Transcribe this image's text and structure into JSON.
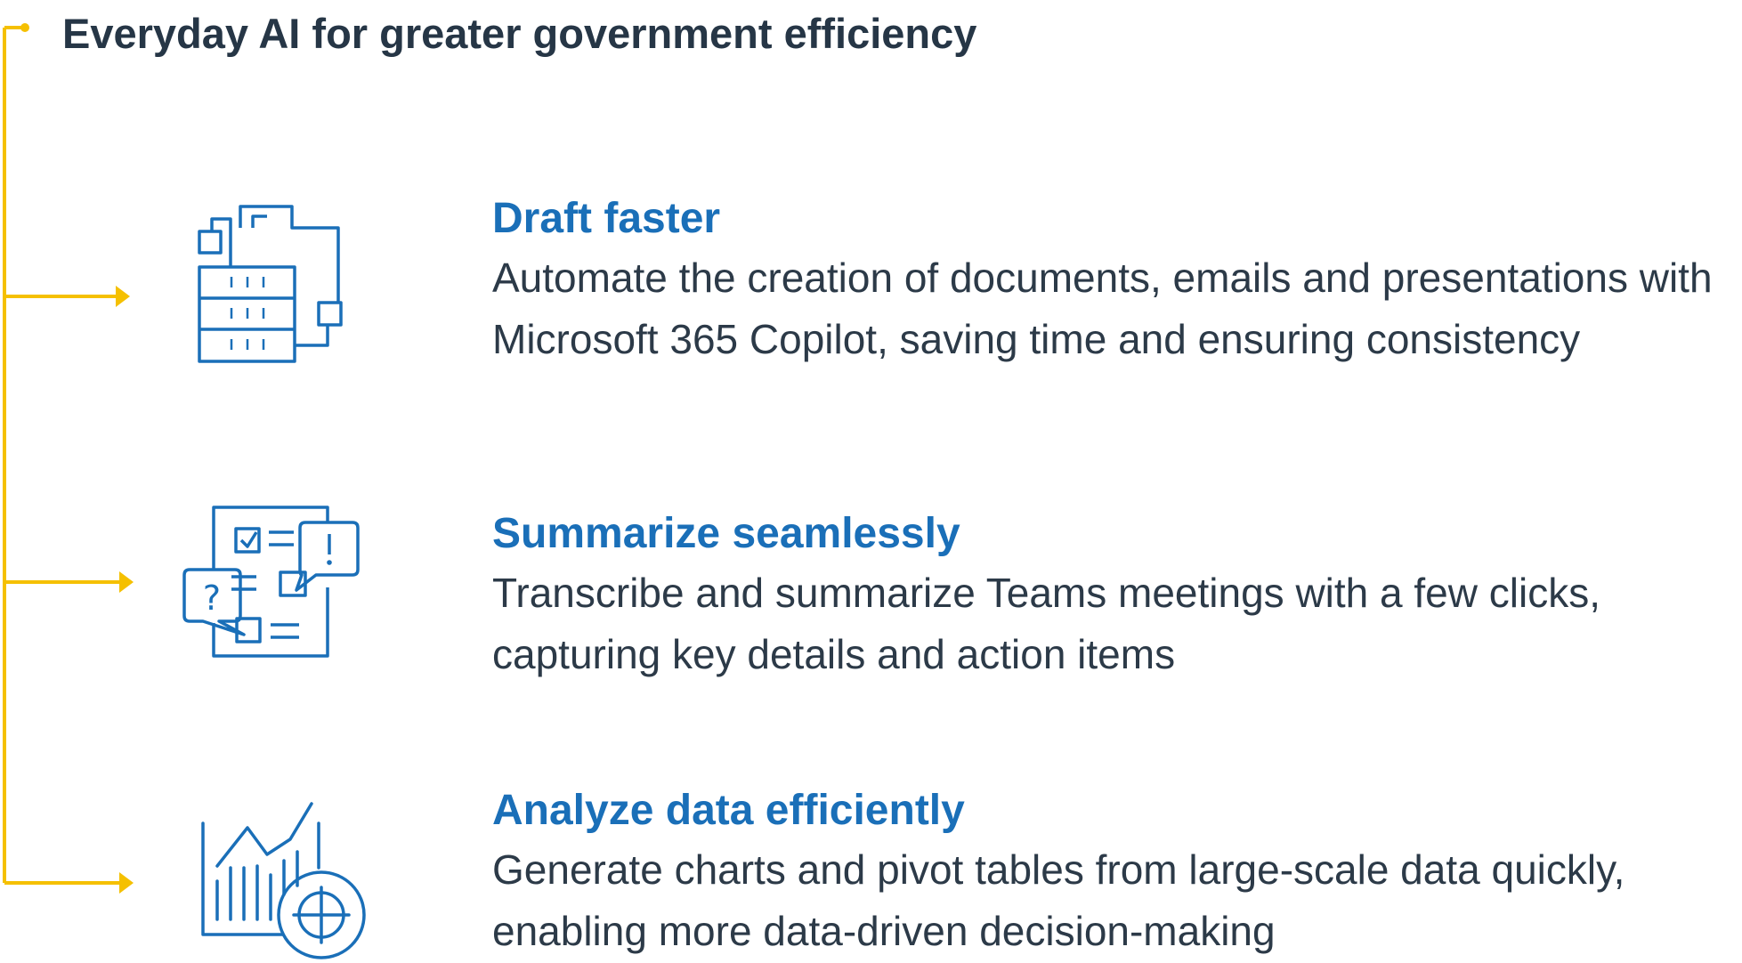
{
  "title": "Everyday AI for greater government efficiency",
  "colors": {
    "connector": "#f5c000",
    "heading": "#1a6fb8",
    "text": "#2c3a48",
    "title": "#263646",
    "icon": "#1a6fb8"
  },
  "items": [
    {
      "icon": "document-table-icon",
      "heading": "Draft faster",
      "text": "Automate the creation of documents, emails and presentations with Microsoft 365 Copilot, saving time and ensuring consistency"
    },
    {
      "icon": "checklist-chat-icon",
      "heading": "Summarize seamlessly",
      "text": "Transcribe and summarize Teams meetings with a few clicks, capturing key details and action items"
    },
    {
      "icon": "chart-target-icon",
      "heading": "Analyze data efficiently",
      "text": "Generate charts and pivot tables from large-scale data quickly, enabling more data-driven decision-making"
    }
  ]
}
